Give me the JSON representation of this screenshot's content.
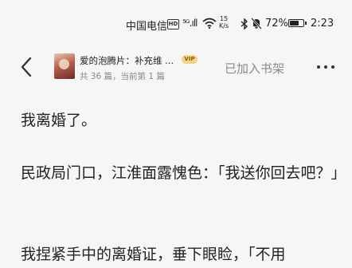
{
  "status_bar": {
    "carrier": "中国电信",
    "hd": "HD",
    "signal": "⁵ᴳ.ıll",
    "speed_value": "15",
    "speed_unit": "K/s",
    "battery": "72%",
    "battery_level": 0.72,
    "time": "2:23"
  },
  "header": {
    "book_title": "爱的泡腾片：补充维 ...",
    "vip_badge": "VIP",
    "book_subtitle": "共 36 篇，当前第 1 篇",
    "added_label": "已加入书架"
  },
  "content": {
    "paragraphs": [
      "我离婚了。",
      "民政局门口，江淮面露愧色：「我送你回去吧？」",
      "我捏紧手中的离婚证，垂下眼睑，「不用"
    ]
  }
}
